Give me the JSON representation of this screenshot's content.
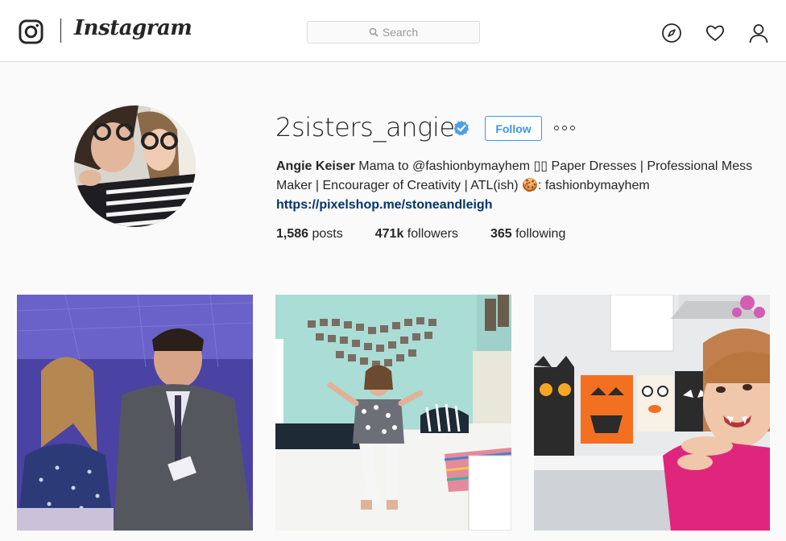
{
  "header": {
    "brand": "Instagram",
    "search_placeholder": "Search",
    "icons": [
      "instagram-camera-icon",
      "search-icon",
      "compass-icon",
      "heart-icon",
      "user-icon"
    ]
  },
  "profile": {
    "username": "2sisters_angie",
    "verified": true,
    "follow_label": "Follow",
    "full_name": "Angie Keiser",
    "bio_line1": "Mama to @fashionbymayhem ▯▯ Paper Dresses | Professional Mess",
    "bio_line2": "Maker | Encourager of Creativity | ATL(ish) 🍪: fashionbymayhem",
    "website": "https://pixelshop.me/stoneandleigh",
    "stats": {
      "posts_count": "1,586",
      "posts_label": "posts",
      "followers_count": "471k",
      "followers_label": "followers",
      "following_count": "365",
      "following_label": "following"
    }
  },
  "posts": [
    {
      "id": "post-1"
    },
    {
      "id": "post-2"
    },
    {
      "id": "post-3"
    }
  ],
  "colors": {
    "accent": "#3897f0",
    "link": "#003569",
    "text": "#262626",
    "border": "#dbdbdb",
    "background": "#fafafa"
  }
}
